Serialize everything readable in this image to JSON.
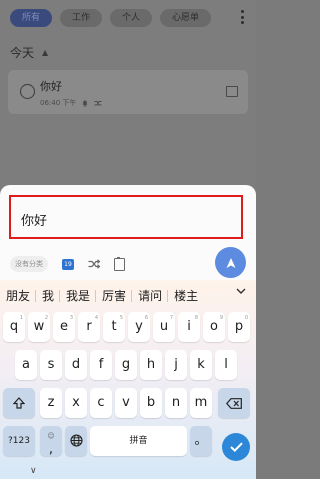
{
  "app": {
    "tabs": [
      {
        "label": "所有",
        "active": true
      },
      {
        "label": "工作",
        "active": false
      },
      {
        "label": "个人",
        "active": false
      },
      {
        "label": "心愿单",
        "active": false
      }
    ],
    "more_icon": "kebab-menu-icon",
    "section": {
      "title": "今天",
      "caret": "▲"
    },
    "task": {
      "title": "你好",
      "time": "06:40 下午",
      "meta_icons": [
        "bell-icon",
        "repeat-icon"
      ],
      "flag_icon": "flag-icon"
    }
  },
  "input_sheet": {
    "text": "你好",
    "category_chip": "没有分类",
    "calendar_icon_text": "19",
    "toolbar_icons": [
      "calendar-icon",
      "repeat-icon",
      "clipboard-icon"
    ],
    "send_icon": "send-icon",
    "colors": {
      "highlight_border": "#e01b1b",
      "send": "#5d8be0"
    }
  },
  "keyboard": {
    "candidates": [
      "朋友",
      "我",
      "我是",
      "厉害",
      "请问",
      "楼主"
    ],
    "expand_icon": "chevron-down-icon",
    "row1": [
      {
        "key": "q",
        "hint": "1"
      },
      {
        "key": "w",
        "hint": "2"
      },
      {
        "key": "e",
        "hint": "3"
      },
      {
        "key": "r",
        "hint": "4"
      },
      {
        "key": "t",
        "hint": "5"
      },
      {
        "key": "y",
        "hint": "6"
      },
      {
        "key": "u",
        "hint": "7"
      },
      {
        "key": "i",
        "hint": "8"
      },
      {
        "key": "o",
        "hint": "9"
      },
      {
        "key": "p",
        "hint": "0"
      }
    ],
    "row2": [
      "a",
      "s",
      "d",
      "f",
      "g",
      "h",
      "j",
      "k",
      "l"
    ],
    "row3": [
      "z",
      "x",
      "c",
      "v",
      "b",
      "n",
      "m"
    ],
    "shift_icon": "shift-icon",
    "backspace_icon": "backspace-icon",
    "row4": {
      "symbols": "?123",
      "punct_top": "☺",
      "punct": ",",
      "globe_icon": "globe-icon",
      "space": "拼音",
      "period": "。"
    },
    "done_icon": "checkmark-icon",
    "hide_label": "∨"
  }
}
